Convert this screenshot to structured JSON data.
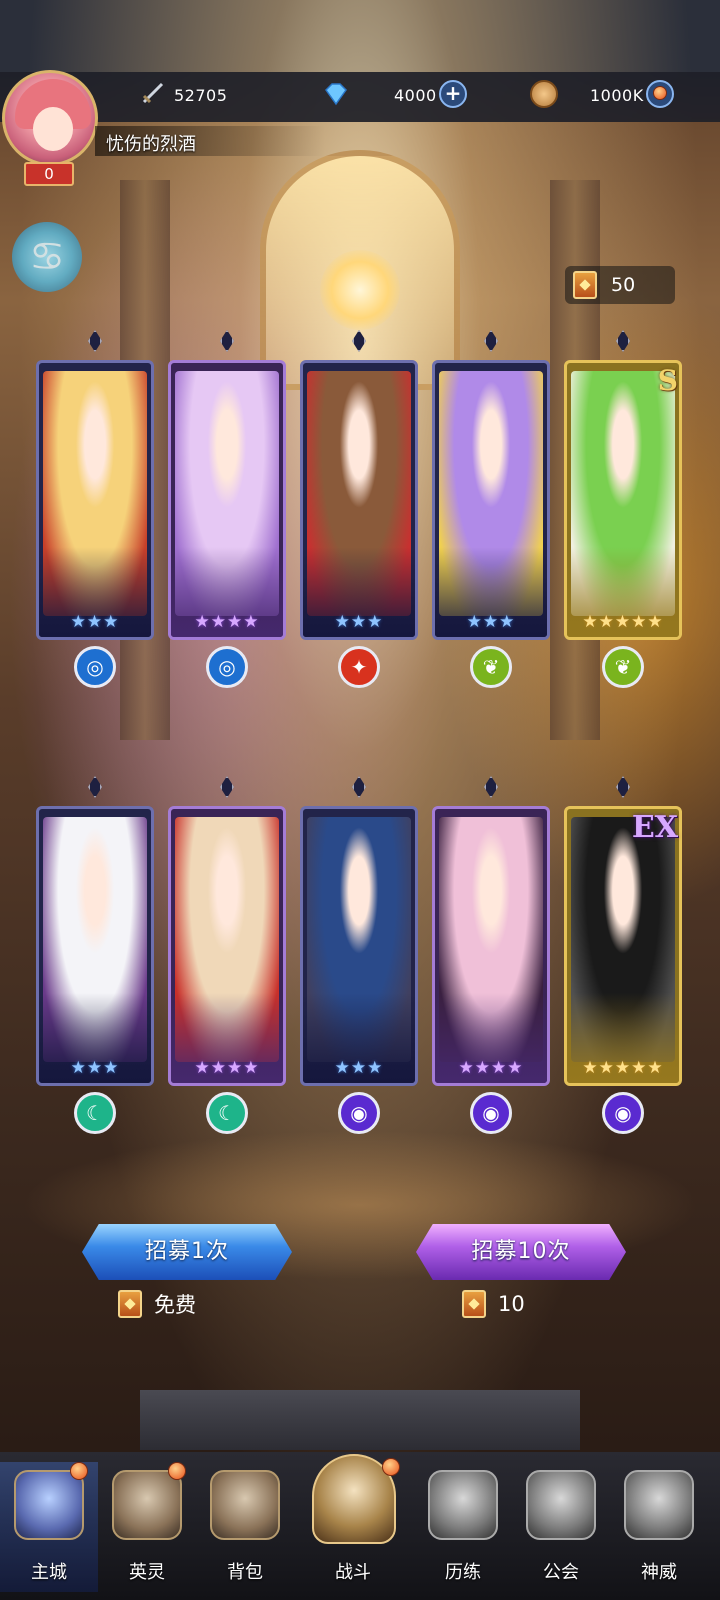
{
  "header": {
    "power": "52705",
    "diamonds": "4000",
    "gold": "1000K",
    "player_name": "忧伤的烈酒",
    "player_level": "0",
    "zodiac_symbol": "♋"
  },
  "recruit": {
    "ticket_count": "50",
    "single_label": "招募1次",
    "single_cost": "免费",
    "ten_label": "招募10次",
    "ten_cost": "10"
  },
  "cards": [
    {
      "stars": "★★★",
      "element": "water",
      "element_glyph": "◎",
      "rarity": "blue"
    },
    {
      "stars": "★★★★",
      "element": "water",
      "element_glyph": "◎",
      "rarity": "purple"
    },
    {
      "stars": "★★★",
      "element": "fire",
      "element_glyph": "✦",
      "rarity": "blue"
    },
    {
      "stars": "★★★",
      "element": "nature",
      "element_glyph": "❦",
      "rarity": "blue"
    },
    {
      "stars": "★★★★★",
      "element": "nature",
      "element_glyph": "❦",
      "rarity": "gold",
      "badge": "S"
    },
    {
      "stars": "★★★",
      "element": "wind",
      "element_glyph": "☾",
      "rarity": "blue"
    },
    {
      "stars": "★★★★",
      "element": "wind",
      "element_glyph": "☾",
      "rarity": "purple"
    },
    {
      "stars": "★★★",
      "element": "dark",
      "element_glyph": "◉",
      "rarity": "blue"
    },
    {
      "stars": "★★★★",
      "element": "dark",
      "element_glyph": "◉",
      "rarity": "purple"
    },
    {
      "stars": "★★★★★",
      "element": "dark",
      "element_glyph": "◉",
      "rarity": "gold",
      "badge": "EX"
    }
  ],
  "nav": [
    {
      "label": "主城"
    },
    {
      "label": "英灵"
    },
    {
      "label": "背包"
    },
    {
      "label": "战斗"
    },
    {
      "label": "历练"
    },
    {
      "label": "公会"
    },
    {
      "label": "神威"
    }
  ],
  "colors": {
    "element_water": "#1e6fd0",
    "element_fire": "#d8321e",
    "element_nature": "#7ab41e",
    "element_wind": "#1eb48a",
    "element_dark": "#5a2ad0"
  }
}
